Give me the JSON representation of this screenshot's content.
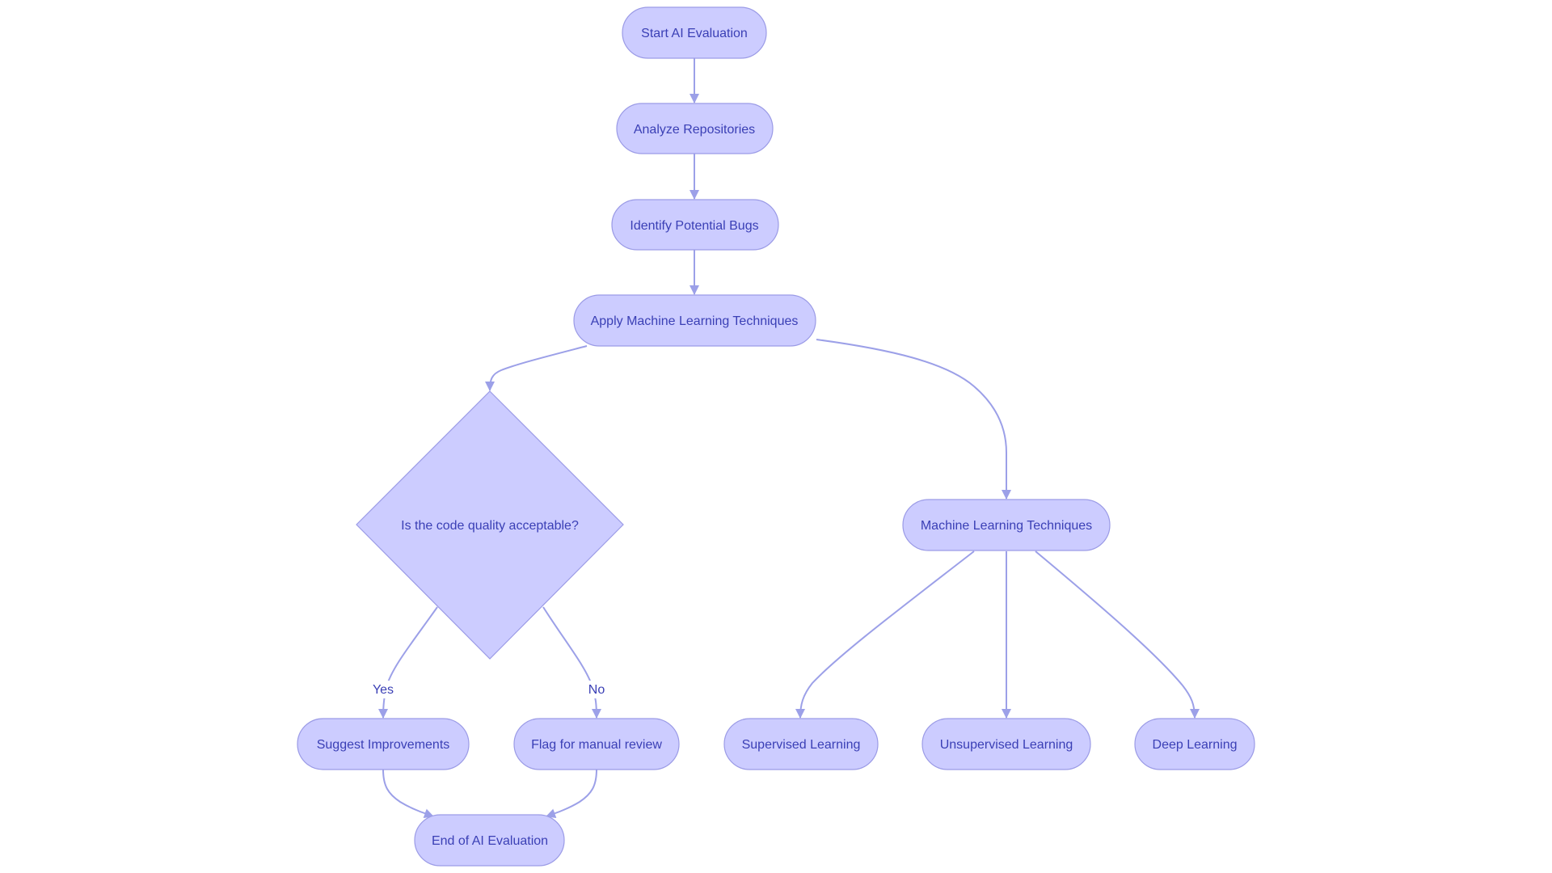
{
  "diagram": {
    "type": "flowchart",
    "colors": {
      "node_fill": "#ccccff",
      "node_stroke": "#9b9be6",
      "text": "#3a3fb5",
      "edge": "#9ca0e8"
    },
    "nodes": {
      "start": {
        "label": "Start AI Evaluation",
        "shape": "stadium"
      },
      "analyze": {
        "label": "Analyze Repositories",
        "shape": "stadium"
      },
      "identify": {
        "label": "Identify Potential Bugs",
        "shape": "stadium"
      },
      "apply_ml": {
        "label": "Apply Machine Learning Techniques",
        "shape": "stadium"
      },
      "decision": {
        "label": "Is the code quality acceptable?",
        "shape": "diamond"
      },
      "ml_techniques": {
        "label": "Machine Learning Techniques",
        "shape": "stadium"
      },
      "suggest": {
        "label": "Suggest Improvements",
        "shape": "stadium"
      },
      "flag": {
        "label": "Flag for manual review",
        "shape": "stadium"
      },
      "supervised": {
        "label": "Supervised Learning",
        "shape": "stadium"
      },
      "unsupervised": {
        "label": "Unsupervised Learning",
        "shape": "stadium"
      },
      "deep": {
        "label": "Deep Learning",
        "shape": "stadium"
      },
      "end": {
        "label": "End of AI Evaluation",
        "shape": "stadium"
      }
    },
    "edges": [
      {
        "from": "start",
        "to": "analyze",
        "label": ""
      },
      {
        "from": "analyze",
        "to": "identify",
        "label": ""
      },
      {
        "from": "identify",
        "to": "apply_ml",
        "label": ""
      },
      {
        "from": "apply_ml",
        "to": "decision",
        "label": ""
      },
      {
        "from": "apply_ml",
        "to": "ml_techniques",
        "label": ""
      },
      {
        "from": "decision",
        "to": "suggest",
        "label": "Yes"
      },
      {
        "from": "decision",
        "to": "flag",
        "label": "No"
      },
      {
        "from": "ml_techniques",
        "to": "supervised",
        "label": ""
      },
      {
        "from": "ml_techniques",
        "to": "unsupervised",
        "label": ""
      },
      {
        "from": "ml_techniques",
        "to": "deep",
        "label": ""
      },
      {
        "from": "suggest",
        "to": "end",
        "label": ""
      },
      {
        "from": "flag",
        "to": "end",
        "label": ""
      }
    ]
  }
}
